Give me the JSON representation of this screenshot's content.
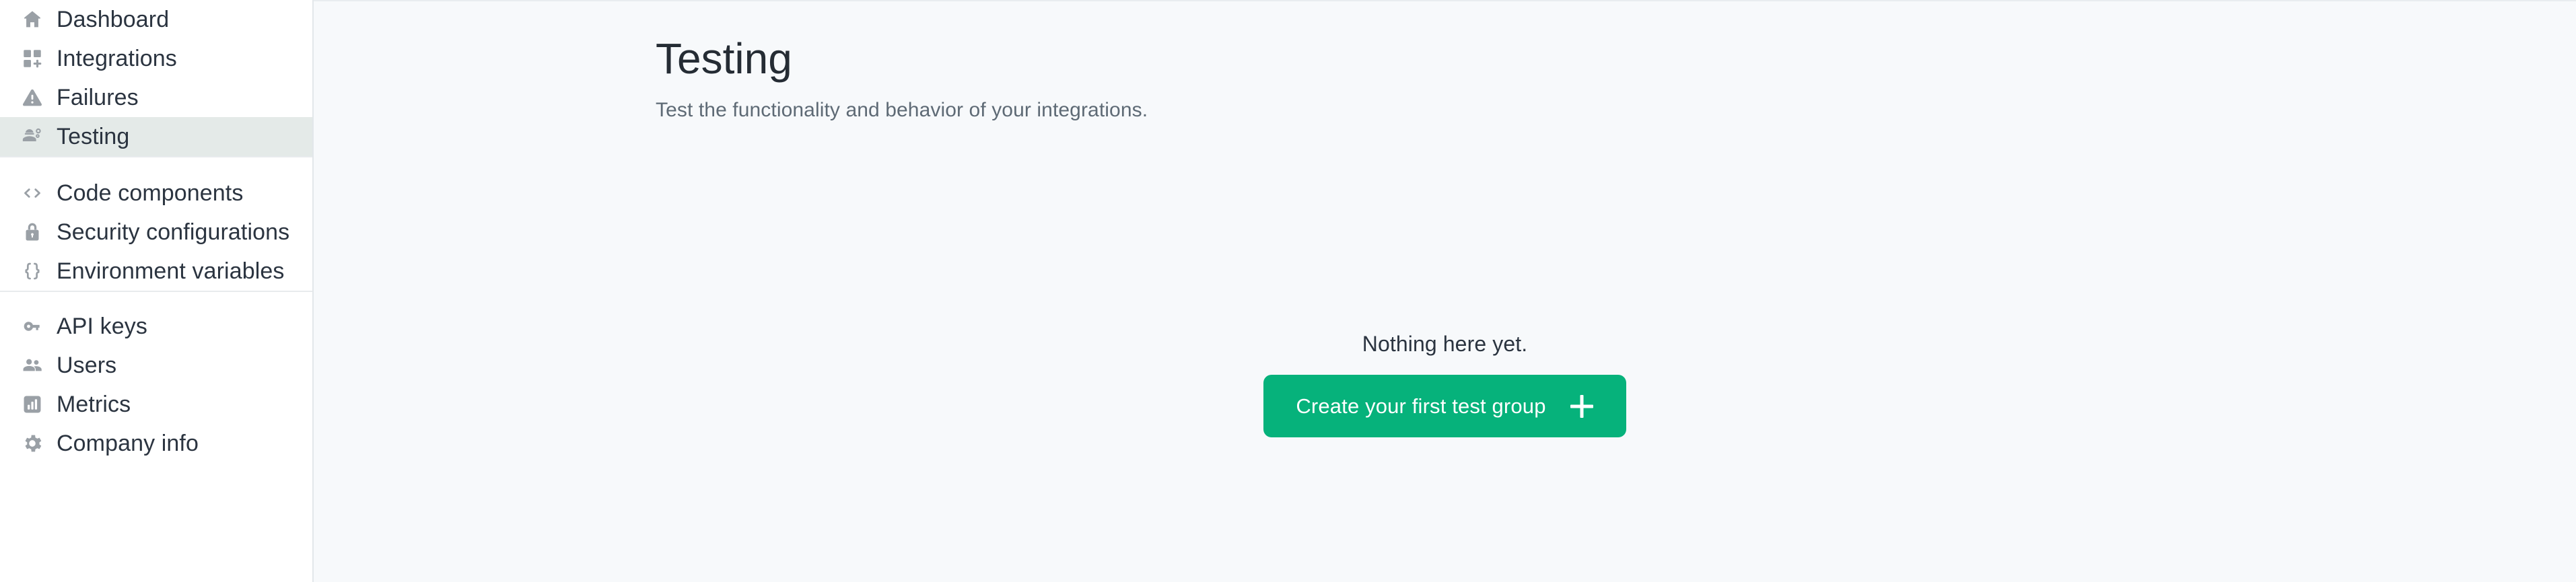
{
  "sidebar": {
    "groups": [
      {
        "items": [
          {
            "label": "Dashboard",
            "icon": "home-icon",
            "active": false
          },
          {
            "label": "Integrations",
            "icon": "grid-add-icon",
            "active": false
          },
          {
            "label": "Failures",
            "icon": "warning-triangle-icon",
            "active": false
          },
          {
            "label": "Testing",
            "icon": "engineering-icon",
            "active": true
          }
        ]
      },
      {
        "items": [
          {
            "label": "Code components",
            "icon": "code-brackets-icon",
            "active": false
          },
          {
            "label": "Security configurations",
            "icon": "lock-icon",
            "active": false
          },
          {
            "label": "Environment variables",
            "icon": "curly-braces-icon",
            "active": false
          }
        ]
      },
      {
        "items": [
          {
            "label": "API keys",
            "icon": "key-icon",
            "active": false
          },
          {
            "label": "Users",
            "icon": "people-icon",
            "active": false
          },
          {
            "label": "Metrics",
            "icon": "bar-chart-icon",
            "active": false
          },
          {
            "label": "Company info",
            "icon": "gear-icon",
            "active": false
          }
        ]
      }
    ]
  },
  "page": {
    "title": "Testing",
    "subtitle": "Test the functionality and behavior of your integrations."
  },
  "empty_state": {
    "message": "Nothing here yet.",
    "button_label": "Create your first test group",
    "button_icon": "plus-icon"
  },
  "colors": {
    "accent_green": "#06b27b",
    "active_item_bg": "#e4eae8",
    "main_bg": "#f7f9fb",
    "sidebar_bg": "#ffffff",
    "text_primary": "#2b3440",
    "text_secondary": "#5e6a75",
    "icon_gray": "#9aa0a6",
    "divider": "#e8ebed"
  }
}
